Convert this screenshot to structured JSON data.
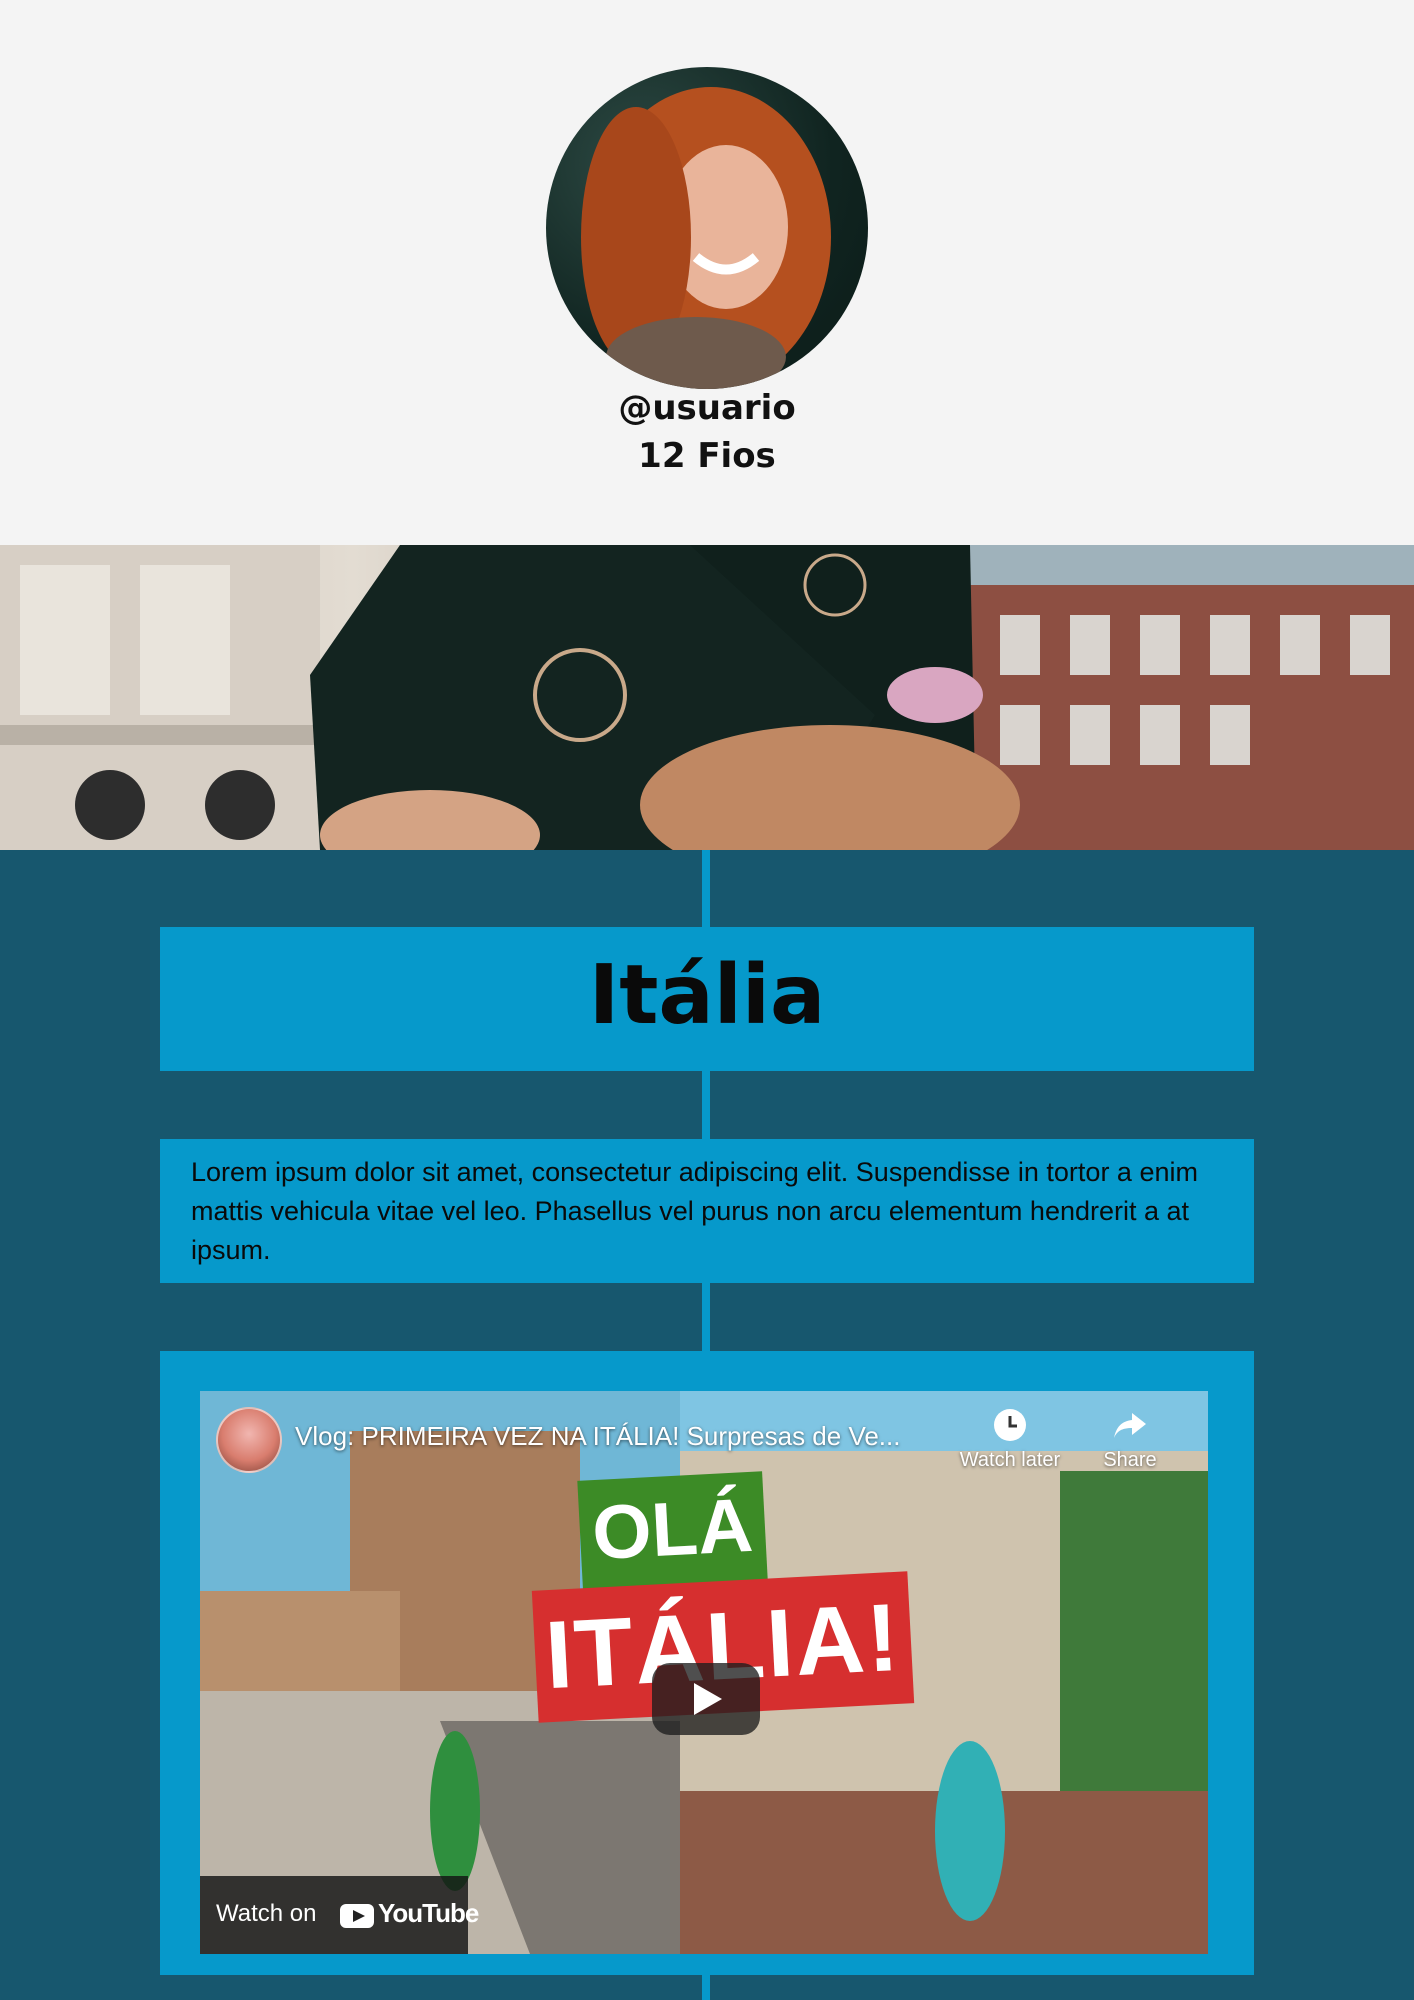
{
  "profile": {
    "handle": "@usuario",
    "thread_count": "12 Fios"
  },
  "timeline": {
    "title": "Itália",
    "description": "Lorem ipsum dolor sit amet, consectetur adipiscing elit. Suspendisse in tortor a enim mattis vehicula vitae vel leo. Phasellus vel purus non arcu elementum hendrerit a at ipsum.",
    "video": {
      "title": "Vlog: PRIMEIRA VEZ NA ITÁLIA! Surpresas de Ve...",
      "watch_later_label": "Watch later",
      "share_label": "Share",
      "watch_on_label": "Watch on",
      "youtube_label": "YouTube",
      "thumb_line1": "OLÁ",
      "thumb_line2": "ITÁLIA!"
    }
  },
  "colors": {
    "page_bg": "#f4f4f4",
    "timeline_bg": "#17576e",
    "card_bg": "#0699cb",
    "thumb_green": "#3c8b26",
    "thumb_red": "#d62f2f"
  }
}
